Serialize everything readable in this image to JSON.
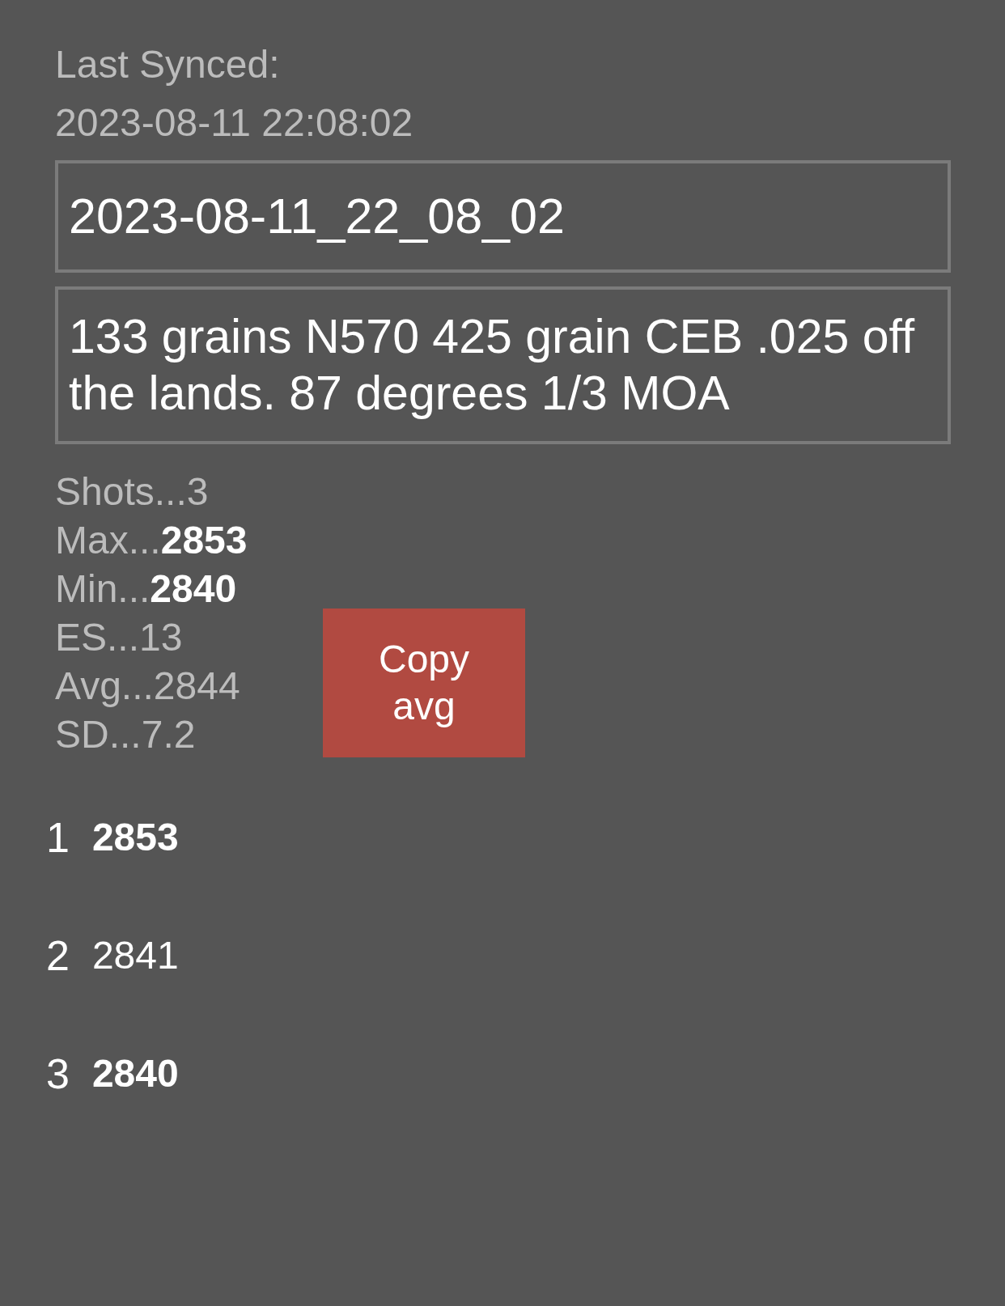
{
  "sync": {
    "label": "Last Synced:",
    "timestamp": "2023-08-11 22:08:02"
  },
  "fields": [
    {
      "kind": "single_line",
      "value": "2023-08-11_22_08_02"
    },
    {
      "kind": "multi_line",
      "value": "133 grains N570 425 grain CEB .025 off the lands. 87 degrees 1/3 MOA"
    }
  ],
  "stats": [
    "Shots...3",
    "Max...**2853**",
    "Min...**2840**",
    "ES...13",
    "Avg...2844",
    "SD...7.2"
  ],
  "copy_button": {
    "label": "Copy avg"
  },
  "shots": [
    {
      "number": "1",
      "value": "2853",
      "highlighted": true
    },
    {
      "number": "2",
      "value": "2841",
      "highlighted": false
    },
    {
      "number": "3",
      "value": "2840",
      "highlighted": true
    }
  ]
}
